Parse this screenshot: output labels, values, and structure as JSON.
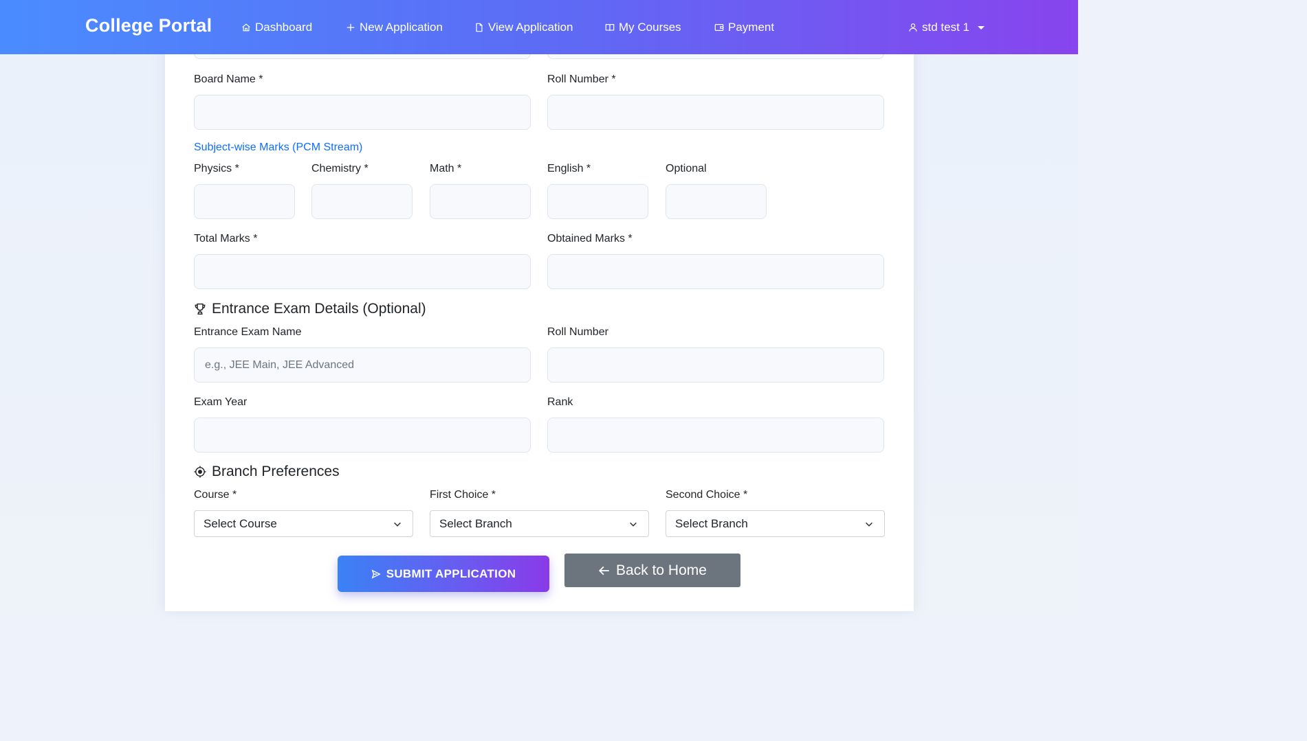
{
  "navbar": {
    "brand": "College Portal",
    "items": [
      {
        "label": "Dashboard",
        "icon": "home-icon"
      },
      {
        "label": "New Application",
        "icon": "plus-icon"
      },
      {
        "label": "View Application",
        "icon": "document-icon"
      },
      {
        "label": "My Courses",
        "icon": "book-icon"
      },
      {
        "label": "Payment",
        "icon": "wallet-icon"
      }
    ],
    "user": {
      "label": "std test 1",
      "icon": "user-icon"
    }
  },
  "form": {
    "board_name_label": "Board Name *",
    "roll_number_label": "Roll Number *",
    "subject_marks_title": "Subject-wise Marks (PCM Stream)",
    "subjects": [
      {
        "label": "Physics *"
      },
      {
        "label": "Chemistry *"
      },
      {
        "label": "Math *"
      },
      {
        "label": "English *"
      },
      {
        "label": "Optional"
      }
    ],
    "total_marks_label": "Total Marks *",
    "obtained_marks_label": "Obtained Marks *",
    "entrance_section_title": "Entrance Exam Details (Optional)",
    "entrance_exam_name_label": "Entrance Exam Name",
    "entrance_exam_name_placeholder": "e.g., JEE Main, JEE Advanced",
    "entrance_roll_number_label": "Roll Number",
    "exam_year_label": "Exam Year",
    "rank_label": "Rank",
    "branch_section_title": "Branch Preferences",
    "course_label": "Course *",
    "course_value": "Select Course",
    "first_choice_label": "First Choice *",
    "first_choice_value": "Select Branch",
    "second_choice_label": "Second Choice *",
    "second_choice_value": "Select Branch"
  },
  "actions": {
    "submit_label": "SUBMIT APPLICATION",
    "back_label": "Back to Home"
  }
}
